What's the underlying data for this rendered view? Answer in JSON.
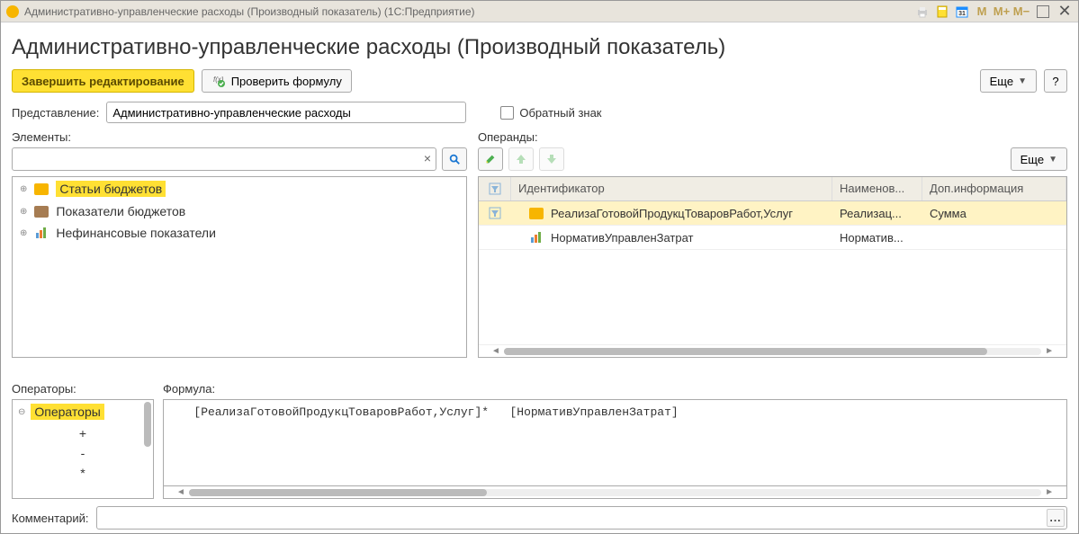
{
  "window": {
    "title": "Административно-управленческие расходы (Производный показатель)  (1С:Предприятие)",
    "mbuttons": {
      "m": "M",
      "mplus": "M+",
      "mminus": "M−"
    }
  },
  "header": {
    "title": "Административно-управленческие расходы (Производный показатель)"
  },
  "toolbar": {
    "finish_label": "Завершить редактирование",
    "check_label": "Проверить формулу",
    "more_label": "Еще",
    "help_label": "?"
  },
  "representation": {
    "label": "Представление:",
    "value": "Административно-управленческие расходы",
    "reverse_label": "Обратный знак",
    "reverse_checked": false
  },
  "elements": {
    "label": "Элементы:",
    "search_value": "",
    "items": [
      {
        "label": "Статьи бюджетов",
        "highlighted": true,
        "icon": "folder-yellow"
      },
      {
        "label": "Показатели бюджетов",
        "highlighted": false,
        "icon": "folder-brown"
      },
      {
        "label": "Нефинансовые показатели",
        "highlighted": false,
        "icon": "chart"
      }
    ]
  },
  "operands": {
    "label": "Операнды:",
    "more_label": "Еще",
    "columns": {
      "id": "Идентификатор",
      "name": "Наименов...",
      "info": "Доп.информация"
    },
    "rows": [
      {
        "icon": "folder-yellow",
        "id": "РеализаГотовойПродукцТоваровРабот,Услуг",
        "name": "Реализац...",
        "info": "Сумма",
        "selected": true
      },
      {
        "icon": "chart",
        "id": "НормативУправленЗатрат",
        "name": "Норматив...",
        "info": "",
        "selected": false
      }
    ]
  },
  "operators": {
    "label": "Операторы:",
    "group_label": "Операторы",
    "items": [
      "+",
      "-",
      "*"
    ]
  },
  "formula": {
    "label": "Формула:",
    "text": "   [РеализаГотовойПродукцТоваровРабот,Услуг]*   [НормативУправленЗатрат]"
  },
  "comment": {
    "label": "Комментарий:",
    "value": ""
  }
}
